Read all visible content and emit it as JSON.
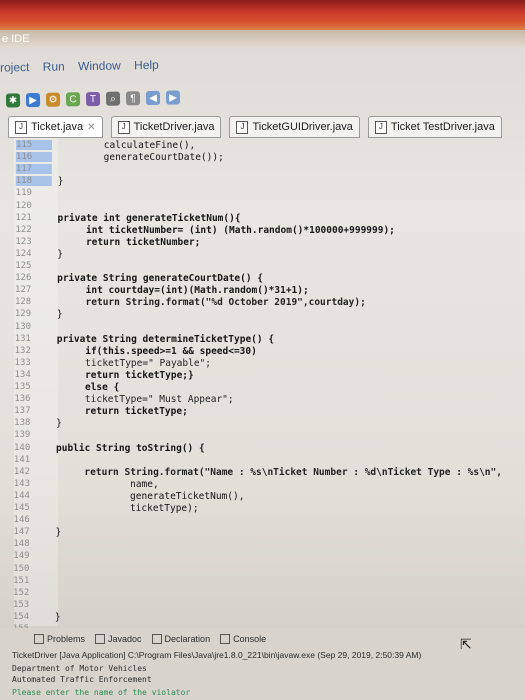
{
  "window": {
    "title": "e IDE"
  },
  "menu": [
    "roject",
    "Run",
    "Window",
    "Help"
  ],
  "tabs": [
    {
      "label": "Ticket.java",
      "active": true
    },
    {
      "label": "TicketDriver.java",
      "active": false
    },
    {
      "label": "TicketGUIDriver.java",
      "active": false
    },
    {
      "label": "Ticket TestDriver.java",
      "active": false
    }
  ],
  "code_lines": [
    {
      "n": "115",
      "text": "        calculateFine(),"
    },
    {
      "n": "116",
      "text": "        generateCourtDate());"
    },
    {
      "n": "117",
      "text": ""
    },
    {
      "n": "118",
      "text": "}"
    },
    {
      "n": "119",
      "text": ""
    },
    {
      "n": "120",
      "text": ""
    },
    {
      "n": "121",
      "text": "private int generateTicketNum(){"
    },
    {
      "n": "122",
      "text": "     int ticketNumber= (int) (Math.random()*100000+999999);"
    },
    {
      "n": "123",
      "text": "     return ticketNumber;"
    },
    {
      "n": "124",
      "text": "}"
    },
    {
      "n": "125",
      "text": ""
    },
    {
      "n": "126",
      "text": "private String generateCourtDate() {"
    },
    {
      "n": "127",
      "text": "     int courtday=(int)(Math.random()*31+1);"
    },
    {
      "n": "128",
      "text": "     return String.format(\"%d October 2019\",courtday);"
    },
    {
      "n": "129",
      "text": "}"
    },
    {
      "n": "130",
      "text": ""
    },
    {
      "n": "131",
      "text": "private String determineTicketType() {"
    },
    {
      "n": "132",
      "text": "     if(this.speed>=1 && speed<=30)"
    },
    {
      "n": "133",
      "text": "     ticketType=\" Payable\";"
    },
    {
      "n": "134",
      "text": "     return ticketType;}"
    },
    {
      "n": "135",
      "text": "     else {"
    },
    {
      "n": "136",
      "text": "     ticketType=\" Must Appear\";"
    },
    {
      "n": "137",
      "text": "     return ticketType;"
    },
    {
      "n": "138",
      "text": "}"
    },
    {
      "n": "139",
      "text": ""
    },
    {
      "n": "140",
      "text": "public String toString() {"
    },
    {
      "n": "141",
      "text": ""
    },
    {
      "n": "142",
      "text": "     return String.format(\"Name : %s\\nTicket Number : %d\\nTicket Type : %s\\n\","
    },
    {
      "n": "143",
      "text": "             name,"
    },
    {
      "n": "144",
      "text": "             generateTicketNum(),"
    },
    {
      "n": "145",
      "text": "             ticketType);"
    },
    {
      "n": "146",
      "text": ""
    },
    {
      "n": "147",
      "text": "}"
    },
    {
      "n": "148",
      "text": ""
    },
    {
      "n": "149",
      "text": ""
    },
    {
      "n": "150",
      "text": ""
    },
    {
      "n": "151",
      "text": ""
    },
    {
      "n": "152",
      "text": ""
    },
    {
      "n": "153",
      "text": ""
    },
    {
      "n": "154",
      "text": "}"
    },
    {
      "n": "155",
      "text": ""
    }
  ],
  "bottom": {
    "tabs": [
      "Problems",
      "Javadoc",
      "Declaration",
      "Console"
    ],
    "console_header": "TicketDriver [Java Application] C:\\Program Files\\Java\\jre1.8.0_221\\bin\\javaw.exe (Sep 29, 2019, 2:50:39 AM)",
    "lines": [
      "Department of Motor Vehicles",
      "Automated Traffic Enforcement",
      "Please enter the name of the violator"
    ]
  }
}
